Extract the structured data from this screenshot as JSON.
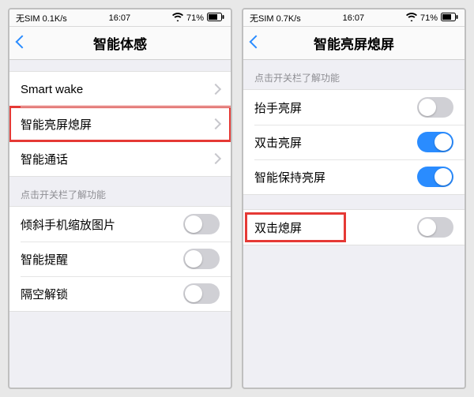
{
  "left": {
    "status": {
      "sim": "无SIM 0.1K/s",
      "time": "16:07",
      "battery": "71%"
    },
    "title": "智能体感",
    "group1": [
      {
        "label": "Smart wake",
        "type": "disclosure"
      },
      {
        "label": "智能亮屏熄屏",
        "type": "disclosure",
        "highlighted": true
      },
      {
        "label": "智能通话",
        "type": "disclosure"
      }
    ],
    "section_hint": "点击开关栏了解功能",
    "group2": [
      {
        "label": "倾斜手机缩放图片",
        "type": "toggle",
        "on": false
      },
      {
        "label": "智能提醒",
        "type": "toggle",
        "on": false
      },
      {
        "label": "隔空解锁",
        "type": "toggle",
        "on": false
      }
    ]
  },
  "right": {
    "status": {
      "sim": "无SIM 0.7K/s",
      "time": "16:07",
      "battery": "71%"
    },
    "title": "智能亮屏熄屏",
    "section_hint": "点击开关栏了解功能",
    "group1": [
      {
        "label": "抬手亮屏",
        "type": "toggle",
        "on": false
      },
      {
        "label": "双击亮屏",
        "type": "toggle",
        "on": true
      },
      {
        "label": "智能保持亮屏",
        "type": "toggle",
        "on": true
      }
    ],
    "group2": [
      {
        "label": "双击熄屏",
        "type": "toggle",
        "on": false,
        "highlighted": true
      }
    ]
  },
  "icons": {
    "wifi": "📶",
    "batt": "🔋"
  }
}
